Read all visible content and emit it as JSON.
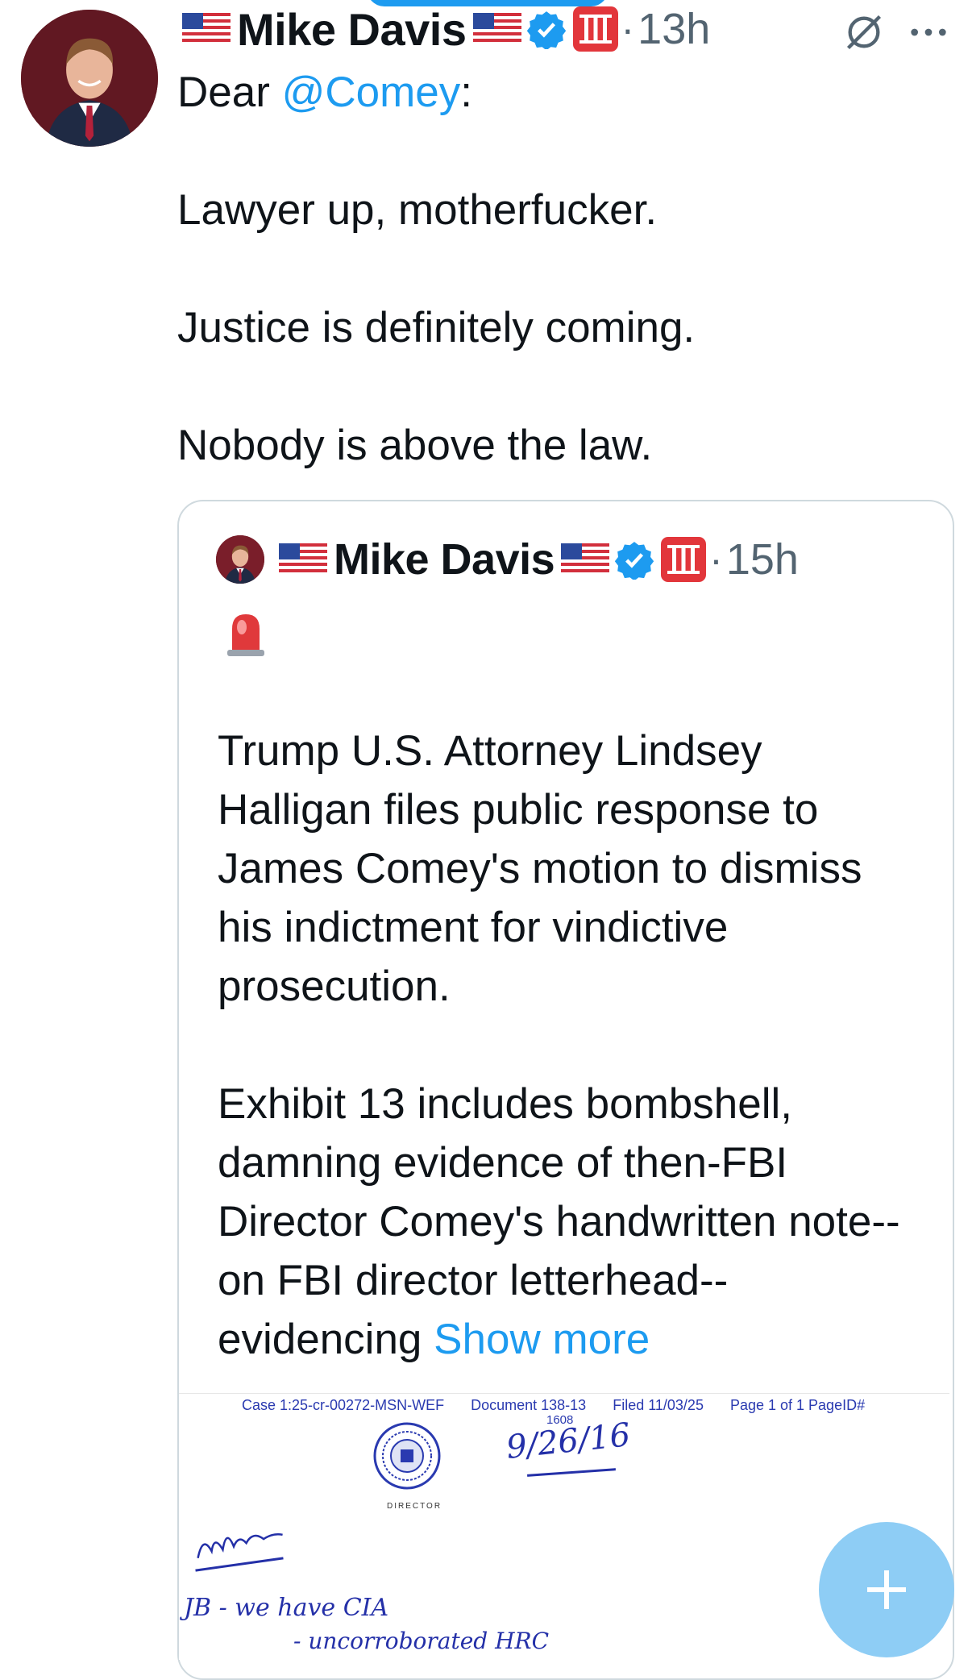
{
  "tweet": {
    "author_name": "Mike Davis",
    "time": "13h",
    "dot": "·",
    "text": {
      "line1_prefix": "Dear ",
      "mention": "@Comey",
      "line1_suffix": ":",
      "line2": "Lawyer up, motherfucker.",
      "line3": "Justice is definitely coming.",
      "line4": "Nobody is above the law."
    }
  },
  "quote": {
    "author_name": "Mike Davis",
    "time": "15h",
    "dot": "·",
    "para1": "Trump U.S. Attorney Lindsey Halligan files public response to James Comey's motion to dismiss his indictment for vindictive prosecution.",
    "para2": "Exhibit 13 includes bombshell, damning evidence of then-FBI Director Comey's handwritten note--on FBI director letterhead--evidencing",
    "show_more": "Show more",
    "document": {
      "case": "Case 1:25-cr-00272-MSN-WEF",
      "doc": "Document 138-13",
      "filed": "Filed 11/03/25",
      "page": "Page 1 of 1 PageID#",
      "page_id": "1608",
      "director_label": "DIRECTOR",
      "handwritten_date": "9/26/16",
      "handwritten_note1": "JB - we have CIA",
      "handwritten_note2": "- uncorroborated HRC"
    }
  },
  "colors": {
    "link": "#1d9bf0",
    "text": "#0f1419",
    "secondary": "#536471",
    "fab": "#8ecdf5",
    "roman_badge": "#e2363b"
  },
  "icons": {
    "verified": "verified-badge-icon",
    "roman": "roman-numeral-three-icon",
    "grok": "grok-icon",
    "more": "more-options-icon",
    "siren": "police-siren-icon",
    "compose": "plus-icon"
  }
}
